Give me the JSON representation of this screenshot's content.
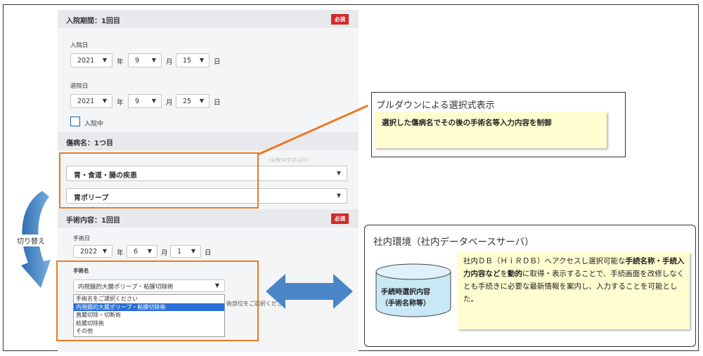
{
  "admission": {
    "header": "入院期間：1回目",
    "badge": "必須",
    "admit_label": "入院日",
    "admit_year": "2021",
    "admit_month": "9",
    "admit_day": "15",
    "discharge_label": "退院日",
    "discharge_year": "2021",
    "discharge_month": "9",
    "discharge_day": "25",
    "unit_year": "年",
    "unit_month": "月",
    "unit_day": "日",
    "inpatient_label": "入院中"
  },
  "disease": {
    "header": "傷病名：1つ目",
    "faint_hint": "(全角50文字以内)",
    "category": "胃・食道・腸の疾患",
    "name": "胃ポリープ"
  },
  "surgery": {
    "header": "手術内容：1回目",
    "badge": "必須",
    "date_label": "手術日",
    "year": "2022",
    "month": "6",
    "day": "1",
    "name_label": "手術名",
    "selected": "内視鏡的大腸ポリープ・粘膜切除術",
    "options": [
      "手術名をご選択ください",
      "内視鏡的大腸ポリープ・粘膜切除術",
      "直腸切除・切断術",
      "結腸切除術",
      "その他"
    ],
    "hidden_hint": "術部位をご選択くださ"
  },
  "annotations": {
    "pulldown_title": "プルダウンによる選択式表示",
    "pulldown_note": "選択した傷病名でその後の手術名等入力内容を制御",
    "switch_label": "切り替え",
    "env_title": "社内環境（社内データベースサーバ）",
    "db_line1": "手続時選択内容",
    "db_line2": "（手術名称等）",
    "desc_pre": "社内ＤＢ（ＨｉＲＤＢ）へアクセスし選択可能な",
    "desc_bold": "手続名称・手続入力内容など",
    "desc_mid": "を",
    "desc_bold2": "動的",
    "desc_post": "に取得・表示することで、手続画面を改修しなくとも手続きに必要な最新情報を案内し、入力することを可能とした。"
  },
  "colors": {
    "accent_orange": "#ea7a22",
    "badge_red": "#d42a2a",
    "checkbox_blue": "#1f5fa8",
    "arrow_blue": "#4a86c8",
    "note_yellow": "#fffed0",
    "selection_blue": "#2a6fd6"
  }
}
